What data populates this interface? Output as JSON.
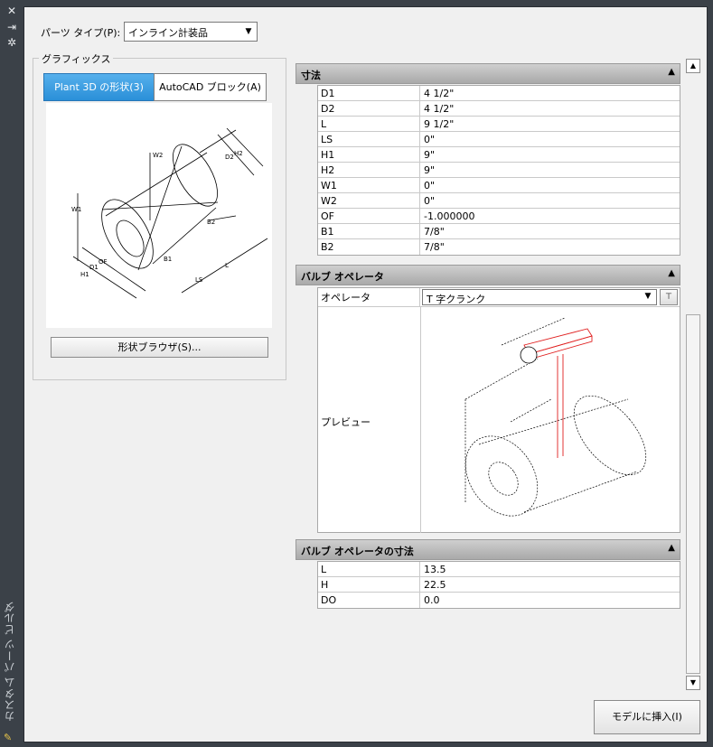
{
  "sidebar": {
    "title": "カスタム パーツ ビルダ",
    "icons": [
      "close-icon",
      "pin-icon",
      "settings-icon",
      "app-icon"
    ]
  },
  "parts_type": {
    "label": "パーツ タイプ(P):",
    "value": "インライン計装品"
  },
  "graphics": {
    "title": "グラフィックス",
    "tabs": [
      "Plant 3D の形状(3)",
      "AutoCAD ブロック(A)"
    ],
    "active_tab": 0,
    "browser_button": "形状ブラウザ(S)..."
  },
  "dimensions": {
    "title": "寸法",
    "rows": [
      {
        "key": "D1",
        "value": "4 1/2\""
      },
      {
        "key": "D2",
        "value": "4 1/2\""
      },
      {
        "key": "L",
        "value": "9 1/2\""
      },
      {
        "key": "LS",
        "value": "0\""
      },
      {
        "key": "H1",
        "value": "9\""
      },
      {
        "key": "H2",
        "value": "9\""
      },
      {
        "key": "W1",
        "value": "0\""
      },
      {
        "key": "W2",
        "value": "0\""
      },
      {
        "key": "OF",
        "value": "-1.000000"
      },
      {
        "key": "B1",
        "value": "7/8\""
      },
      {
        "key": "B2",
        "value": "7/8\""
      }
    ]
  },
  "valve_operator": {
    "title": "バルブ オペレータ",
    "operator_label": "オペレータ",
    "operator_value": "T 字クランク",
    "preview_label": "プレビュー"
  },
  "valve_operator_dims": {
    "title": "バルブ オペレータの寸法",
    "rows": [
      {
        "key": "L",
        "value": "13.5"
      },
      {
        "key": "H",
        "value": "22.5"
      },
      {
        "key": "DO",
        "value": "0.0"
      }
    ]
  },
  "insert_button": "モデルに挿入(I)",
  "drawing_labels": [
    "H2",
    "D2",
    "B2",
    "H1",
    "D1",
    "OF",
    "B1",
    "LS",
    "L",
    "W2",
    "W1"
  ],
  "colors": {
    "active_tab": "#2a8fd8",
    "operator_drawing": "#e02020",
    "sidebar": "#3b4148"
  }
}
